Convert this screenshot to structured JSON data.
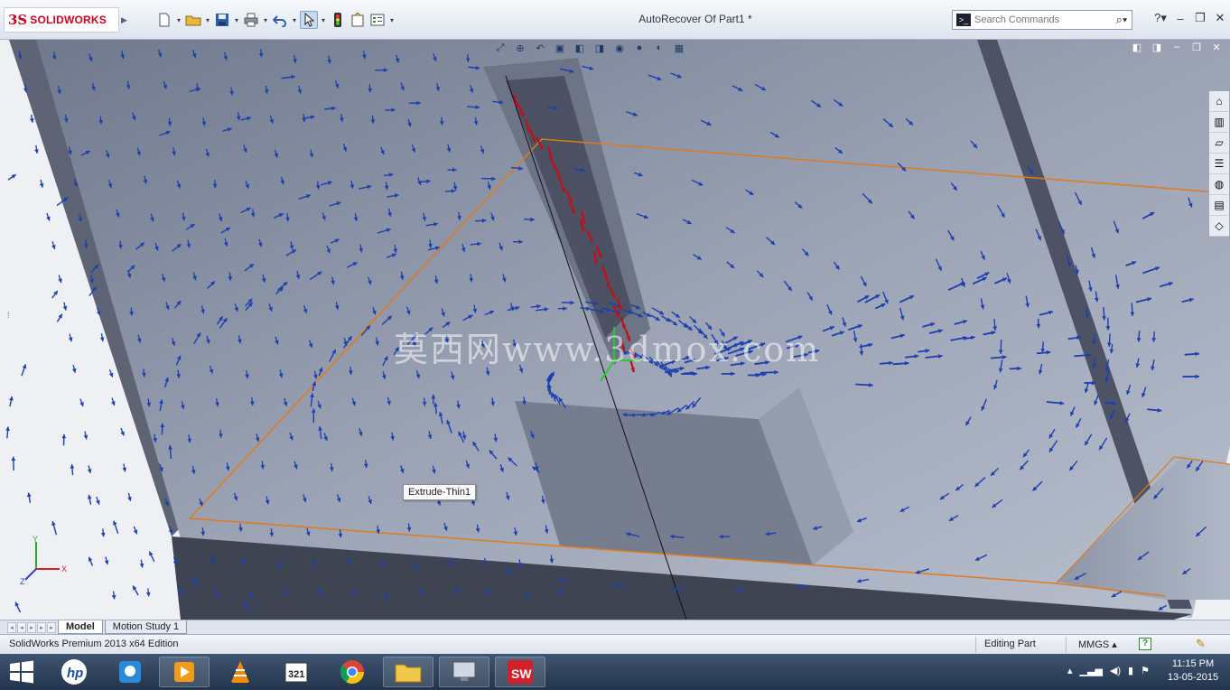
{
  "app": {
    "brand_mark": "3S",
    "brand_name": "SOLIDWORKS",
    "document_title": "AutoRecover Of Part1 *"
  },
  "search": {
    "placeholder": "Search Commands"
  },
  "viewport": {
    "watermark": "莫西网www.3dmox.com",
    "tooltip": "Extrude-Thin1",
    "triad_axes": [
      "Y",
      "X",
      "Z"
    ]
  },
  "bottom_tabs": {
    "model": "Model",
    "motion_study": "Motion Study 1"
  },
  "statusbar": {
    "edition": "SolidWorks Premium 2013 x64 Edition",
    "mode": "Editing Part",
    "units": "MMGS",
    "units_caret": "▴",
    "help_glyph": "?"
  },
  "taskbar": {
    "time": "11:15 PM",
    "date": "13-05-2015"
  },
  "colors": {
    "arrow_blue": "#1b3fb0",
    "arrow_red": "#c0101a",
    "edge_orange": "#e07a1a",
    "body_grey": "#8f96a6"
  },
  "icons": [
    "new-document-icon",
    "open-folder-icon",
    "save-icon",
    "print-icon",
    "undo-icon",
    "select-cursor-icon",
    "traffic-light-icon",
    "options-icon",
    "file-properties-icon",
    "search-icon",
    "help-icon",
    "minimize-icon",
    "restore-icon",
    "close-icon"
  ]
}
